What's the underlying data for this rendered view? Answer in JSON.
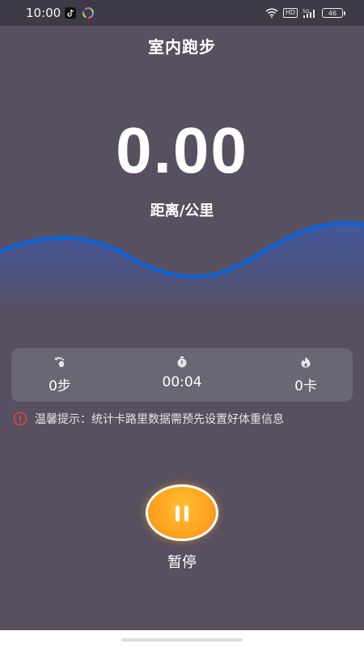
{
  "status_bar": {
    "time": "10:00",
    "hd": "HD",
    "network": "5G",
    "battery": "46"
  },
  "title": "室内跑步",
  "distance": {
    "value": "0.00",
    "label": "距离/公里"
  },
  "stats": {
    "steps": "0步",
    "duration": "00:04",
    "calories": "0卡"
  },
  "tip": "温馨提示：统计卡路里数据需预先设置好体重信息",
  "pause": {
    "label": "暂停"
  },
  "colors": {
    "background": "#575060",
    "wave_line": "#0b63d8",
    "accent_orange": "#ffa521",
    "tip_icon": "#e04545"
  },
  "icons": {
    "steps": "footprint-icon",
    "duration": "stopwatch-icon",
    "calories": "flame-icon",
    "tip": "warning-icon",
    "pause": "pause-icon"
  }
}
